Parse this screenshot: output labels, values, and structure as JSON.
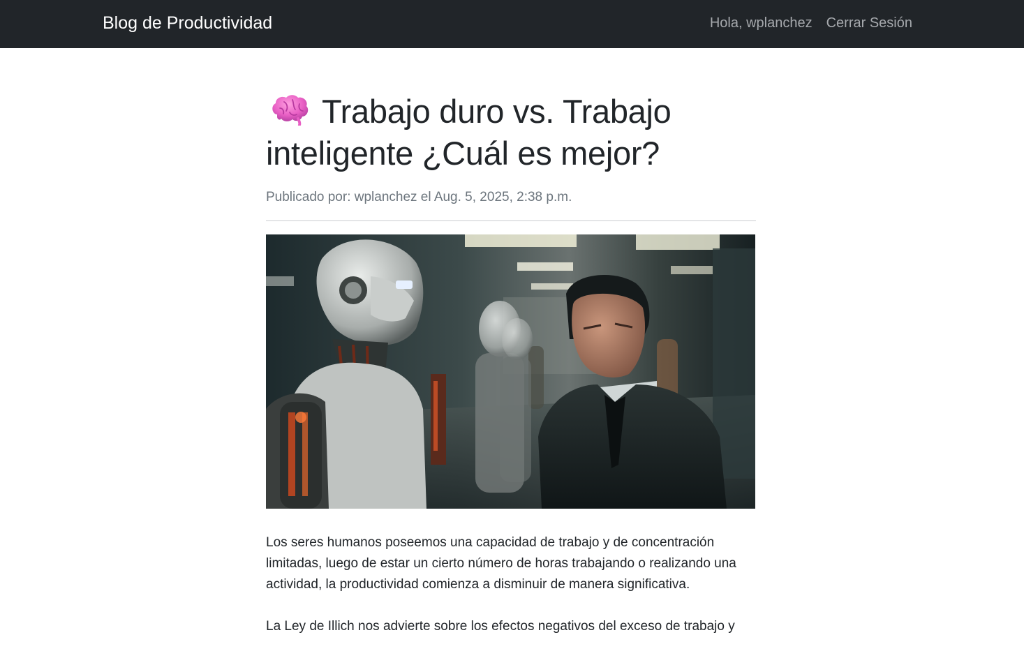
{
  "navbar": {
    "brand": "Blog de Productividad",
    "greeting": "Hola, wplanchez",
    "logout": "Cerrar Sesión"
  },
  "post": {
    "icon": "brain-icon",
    "title": "Trabajo duro vs. Trabajo inteligente ¿Cuál es mejor?",
    "meta": "Publicado por: wplanchez el Aug. 5, 2025, 2:38 p.m.",
    "image": "robots-and-businessman-illustration",
    "paragraphs": [
      "Los seres humanos poseemos una capacidad de trabajo y de concentración limitadas, luego de estar un cierto número de horas trabajando o realizando una actividad, la productividad comienza a disminuir de manera significativa.",
      "La Ley de Illich nos advierte sobre los efectos negativos del exceso de trabajo y"
    ]
  },
  "colors": {
    "navbar_bg": "#212529",
    "brand": "#ffffff",
    "nav_link": "#a6a9ad",
    "meta_text": "#6c757d"
  }
}
